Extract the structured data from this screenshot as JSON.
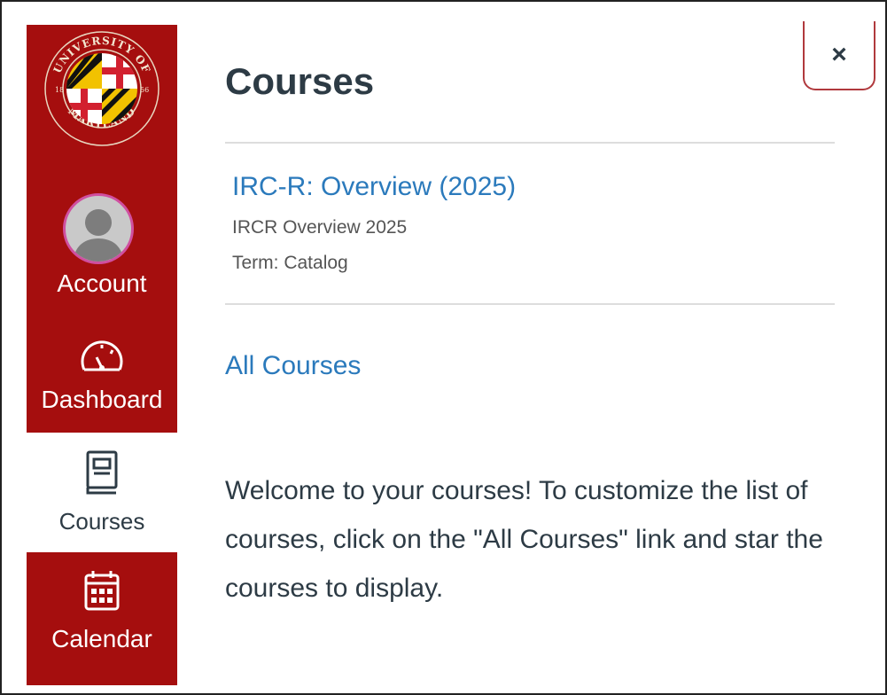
{
  "sidebar": {
    "logo": {
      "text_top": "UNIVERSITY OF",
      "text_bottom": "MARYLAND",
      "year_left": "18",
      "year_right": "56"
    },
    "account_label": "Account",
    "dashboard_label": "Dashboard",
    "courses_label": "Courses",
    "calendar_label": "Calendar"
  },
  "panel": {
    "close_label": "×",
    "title": "Courses",
    "course": {
      "name": "IRC-R: Overview (2025)",
      "subtitle": "IRCR Overview 2025",
      "term": "Term: Catalog"
    },
    "all_courses_label": "All Courses",
    "welcome_text": "Welcome to your courses! To customize the list of courses, click on the \"All Courses\" link and star the courses to display."
  },
  "colors": {
    "brand_red": "#a50e0e",
    "link_blue": "#2b7abc",
    "text_dark": "#2d3b45",
    "avatar_ring": "#d04fa0"
  }
}
